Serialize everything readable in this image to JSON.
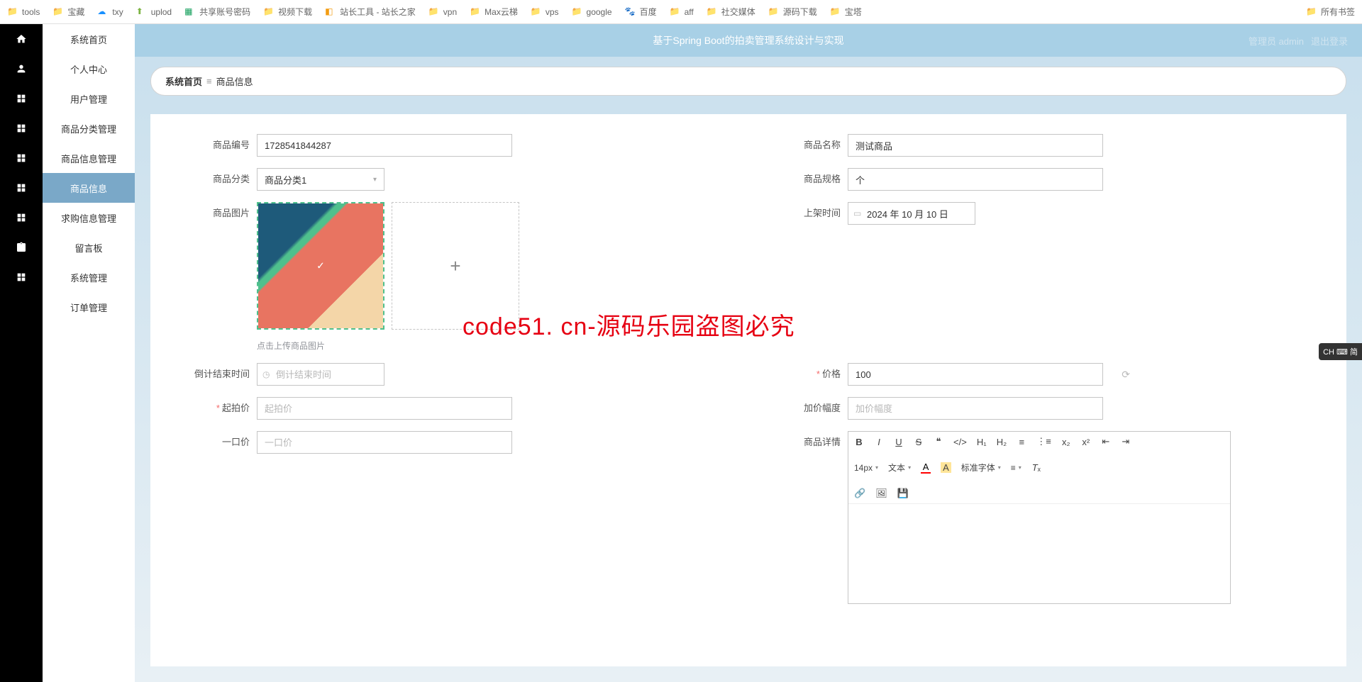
{
  "bookmarks": {
    "left": [
      "tools",
      "宝藏",
      "txy",
      "uplod",
      "共享账号密码",
      "视频下载",
      "站长工具 - 站长之家",
      "vpn",
      "Max云梯",
      "vps",
      "google",
      "百度",
      "aff",
      "社交媒体",
      "源码下载",
      "宝塔"
    ],
    "right": "所有书签"
  },
  "header": {
    "title": "基于Spring Boot的拍卖管理系统设计与实现",
    "role_user": "管理员 admin",
    "logout": "退出登录"
  },
  "sidebar": {
    "items": [
      "系统首页",
      "个人中心",
      "用户管理",
      "商品分类管理",
      "商品信息管理",
      "商品信息",
      "求购信息管理",
      "留言板",
      "系统管理",
      "订单管理"
    ],
    "active_index": 5
  },
  "breadcrumb": {
    "root": "系统首页",
    "current": "商品信息"
  },
  "form": {
    "product_id": {
      "label": "商品编号",
      "value": "1728541844287"
    },
    "product_name": {
      "label": "商品名称",
      "value": "测试商品"
    },
    "category": {
      "label": "商品分类",
      "value": "商品分类1"
    },
    "spec": {
      "label": "商品规格",
      "value": "个"
    },
    "image": {
      "label": "商品图片",
      "hint": "点击上传商品图片"
    },
    "onshelf_time": {
      "label": "上架时间",
      "value": "2024 年 10 月 10 日"
    },
    "countdown_end": {
      "label": "倒计结束时间",
      "placeholder": "倒计结束时间",
      "value": ""
    },
    "price": {
      "label": "价格",
      "value": "100"
    },
    "start_price": {
      "label": "起拍价",
      "placeholder": "起拍价",
      "value": ""
    },
    "step": {
      "label": "加价幅度",
      "placeholder": "加价幅度",
      "value": ""
    },
    "buyout": {
      "label": "一口价",
      "placeholder": "一口价",
      "value": ""
    },
    "detail": {
      "label": "商品详情"
    }
  },
  "editor": {
    "font_size": "14px",
    "text": "文本",
    "font_family": "标准字体"
  },
  "watermark": "code51. cn-源码乐园盗图必究",
  "ime": "CH ⌨ 简"
}
